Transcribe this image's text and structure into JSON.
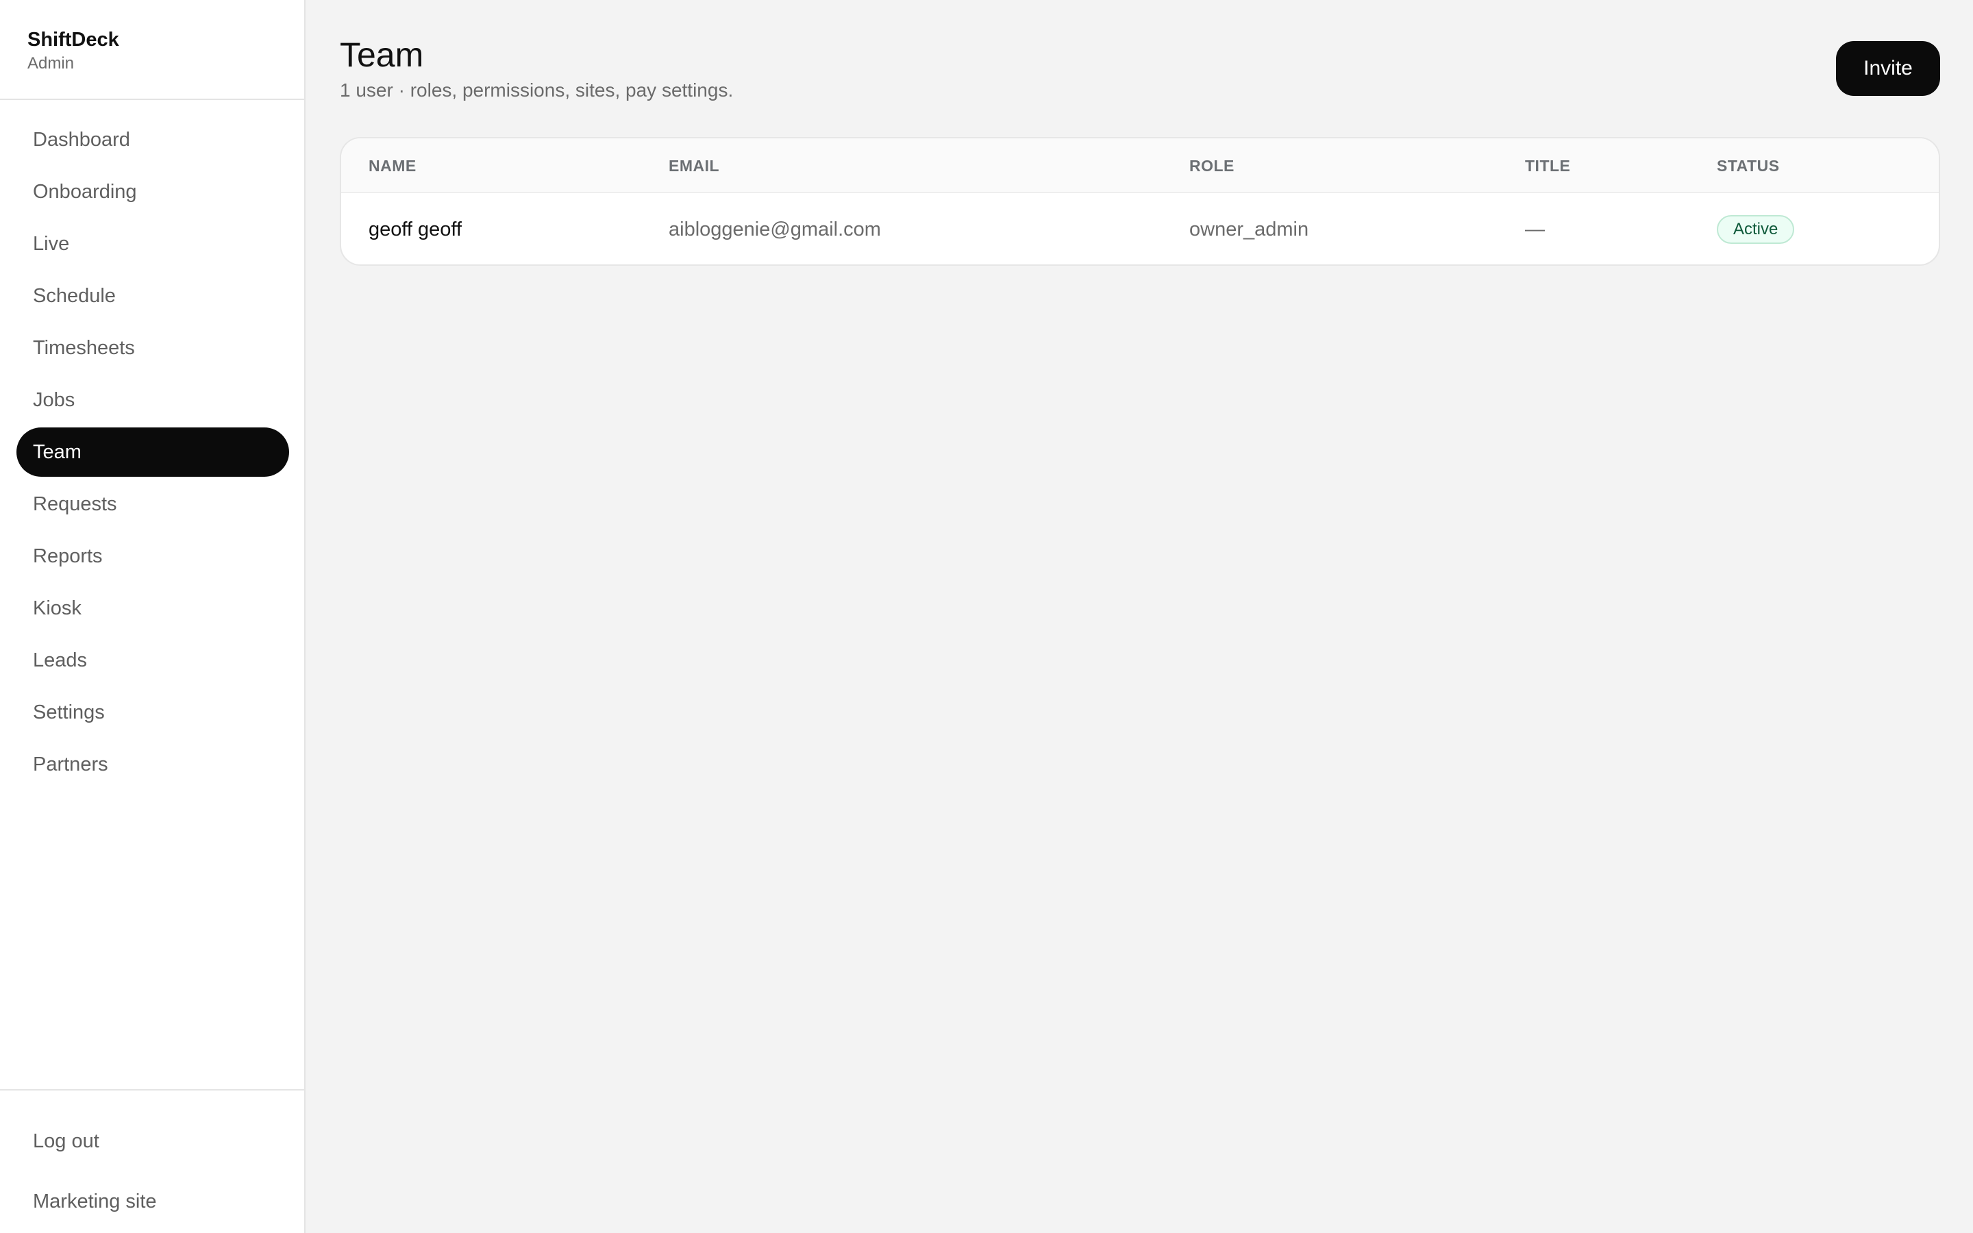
{
  "brand": {
    "name": "ShiftDeck",
    "role": "Admin"
  },
  "nav": {
    "items": [
      {
        "label": "Dashboard"
      },
      {
        "label": "Onboarding"
      },
      {
        "label": "Live"
      },
      {
        "label": "Schedule"
      },
      {
        "label": "Timesheets"
      },
      {
        "label": "Jobs"
      },
      {
        "label": "Team",
        "active": true
      },
      {
        "label": "Requests"
      },
      {
        "label": "Reports"
      },
      {
        "label": "Kiosk"
      },
      {
        "label": "Leads"
      },
      {
        "label": "Settings"
      },
      {
        "label": "Partners"
      }
    ]
  },
  "footer": {
    "logout": "Log out",
    "marketing": "Marketing site"
  },
  "page": {
    "title": "Team",
    "subtitle": "1 user · roles, permissions, sites, pay settings.",
    "invite_label": "Invite"
  },
  "table": {
    "columns": [
      "NAME",
      "EMAIL",
      "ROLE",
      "TITLE",
      "STATUS"
    ],
    "rows": [
      {
        "name": "geoff geoff",
        "email": "aibloggenie@gmail.com",
        "role": "owner_admin",
        "title": "—",
        "status": "Active"
      }
    ]
  },
  "colors": {
    "accent": "#0b0b0b",
    "status_active_bg": "#ecfdf5",
    "status_active_border": "#bfe9d4",
    "status_active_text": "#0f5a3a"
  }
}
